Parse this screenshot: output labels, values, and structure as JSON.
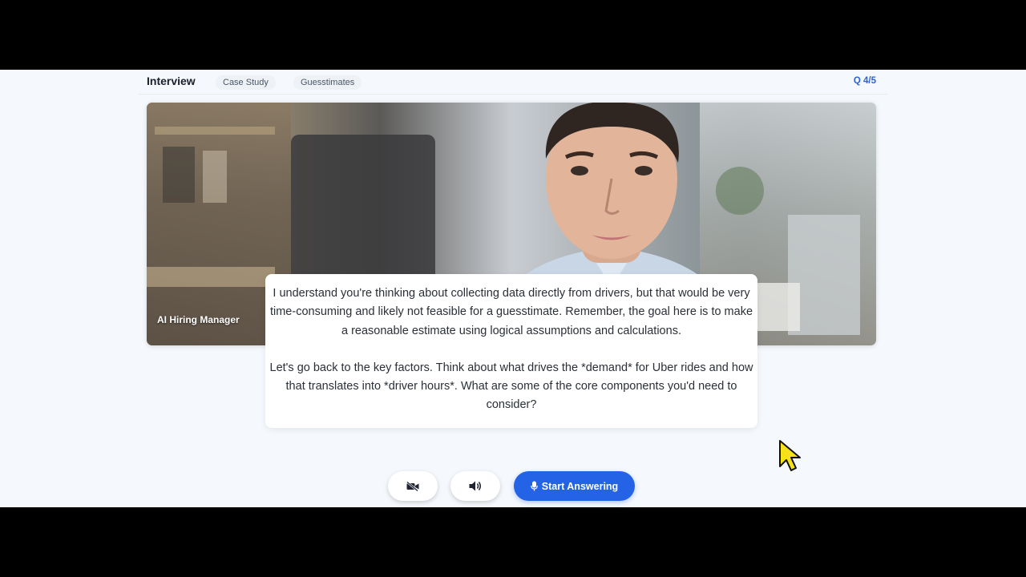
{
  "topbar": {
    "brand": "Interview",
    "tabs": [
      {
        "label": "Case Study"
      },
      {
        "label": "Guesstimates"
      }
    ],
    "question_counter": "Q 4/5"
  },
  "video": {
    "speaker_label": "AI Hiring Manager"
  },
  "caption": {
    "paragraph_1": "I understand you're thinking about collecting data directly from drivers, but that would be very time-consuming and likely not feasible for a guesstimate. Remember, the goal here is to make a reasonable estimate using logical assumptions and calculations.",
    "paragraph_2": "Let's go back to the key factors. Think about what drives the *demand* for Uber rides and how that translates into *driver hours*. What are some of the core components you'd need to consider?"
  },
  "controls": {
    "camera_icon": "camera-off-icon",
    "volume_icon": "speaker-icon",
    "start_label": "Start Answering",
    "start_icon": "microphone-icon"
  },
  "colors": {
    "accent": "#2563e6",
    "counter": "#2b62d9",
    "background": "#f5f8fc"
  }
}
